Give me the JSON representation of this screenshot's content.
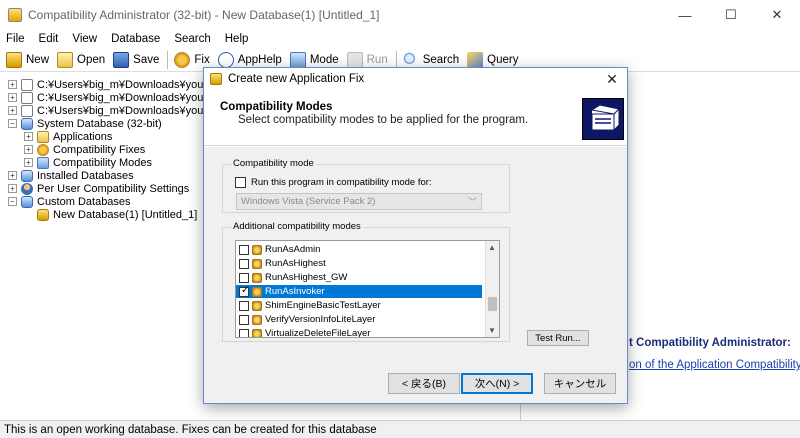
{
  "window": {
    "title": "Compatibility Administrator (32-bit) - New Database(1) [Untitled_1]",
    "minimize": "—",
    "maximize": "☐",
    "close": "✕"
  },
  "menu": [
    "File",
    "Edit",
    "View",
    "Database",
    "Search",
    "Help"
  ],
  "toolbar": {
    "new": "New",
    "open": "Open",
    "save": "Save",
    "fix": "Fix",
    "apphelp": "AppHelp",
    "mode": "Mode",
    "run": "Run",
    "search": "Search",
    "query": "Query"
  },
  "tree": {
    "files": [
      "C:¥Users¥big_m¥Downloads¥youmu¥th0",
      "C:¥Users¥big_m¥Downloads¥youmu¥th0",
      "C:¥Users¥big_m¥Downloads¥youmu¥th0"
    ],
    "system_db": "System Database (32-bit)",
    "applications": "Applications",
    "compat_fixes": "Compatibility Fixes",
    "compat_modes": "Compatibility Modes",
    "installed_db": "Installed Databases",
    "per_user": "Per User Compatibility Settings",
    "custom_db": "Custom Databases",
    "new_db": "New Database(1) [Untitled_1]"
  },
  "right_pane": {
    "heading": "t Compatibility Administrator:",
    "link": "on of the Application Compatibility Toolkit"
  },
  "status": "This is an open working database. Fixes can be created for this database",
  "dialog": {
    "title": "Create new Application Fix",
    "close": "✕",
    "header_title": "Compatibility Modes",
    "header_desc": "Select compatibility modes to be applied for the program.",
    "group1_label": "Compatibility mode",
    "run_compat_label": "Run this program in compatibility mode for:",
    "os_value": "Windows Vista (Service Pack 2)",
    "group2_label": "Additional compatibility modes",
    "modes": [
      {
        "label": "RunAsAdmin",
        "checked": false,
        "selected": false
      },
      {
        "label": "RunAsHighest",
        "checked": false,
        "selected": false
      },
      {
        "label": "RunAsHighest_GW",
        "checked": false,
        "selected": false
      },
      {
        "label": "RunAsInvoker",
        "checked": true,
        "selected": true
      },
      {
        "label": "ShimEngineBasicTestLayer",
        "checked": false,
        "selected": false
      },
      {
        "label": "VerifyVersionInfoLiteLayer",
        "checked": false,
        "selected": false
      },
      {
        "label": "VirtualizeDeleteFileLayer",
        "checked": false,
        "selected": false
      }
    ],
    "test_run": "Test Run...",
    "back": "< 戻る(B)",
    "next": "次へ(N) >",
    "cancel": "キャンセル"
  }
}
